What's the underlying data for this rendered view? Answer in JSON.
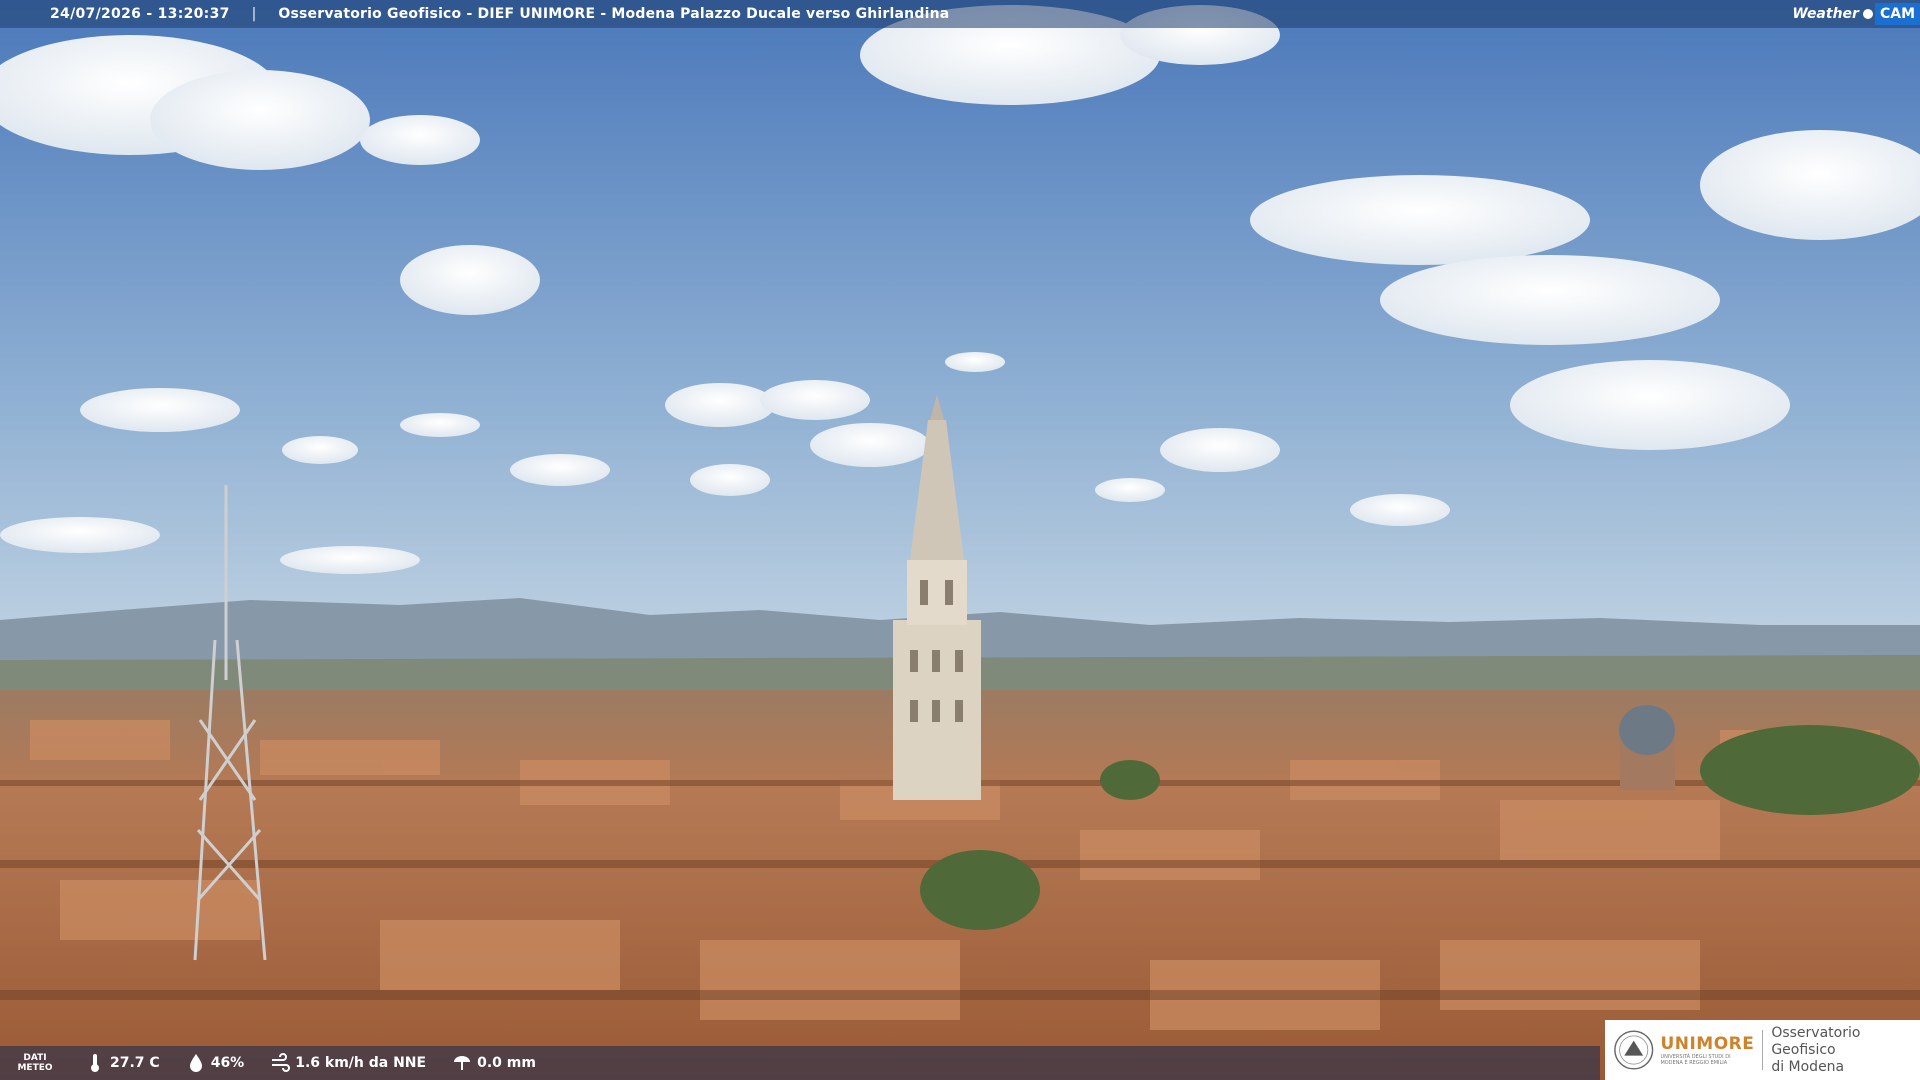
{
  "header": {
    "timestamp": "24/07/2026 - 13:20:37",
    "separator": "|",
    "title": "Osservatorio Geofisico - DIEF UNIMORE - Modena Palazzo Ducale verso Ghirlandina"
  },
  "brand": {
    "weather": "Weather",
    "cam": "CAM"
  },
  "weather_bar": {
    "label_line1": "DATI",
    "label_line2": "METEO",
    "temperature": "27.7 C",
    "humidity": "46%",
    "wind": "1.6 km/h da NNE",
    "rain": "0.0 mm",
    "icons": [
      "thermometer-icon",
      "humidity-drop-icon",
      "wind-icon",
      "rain-icon"
    ]
  },
  "logo": {
    "unimore_prefix": "UNI",
    "unimore_suffix": "MORE",
    "unimore_sub1": "UNIVERSITÀ DEGLI STUDI DI",
    "unimore_sub2": "MODENA E REGGIO EMILIA",
    "observatory_line1": "Osservatorio Geofisico",
    "observatory_line2": "di Modena"
  },
  "colors": {
    "sky_top": "#4f7fc0",
    "sky_bottom": "#a9c3dc",
    "roofs": "#b7774e",
    "accent": "#d0822a"
  }
}
